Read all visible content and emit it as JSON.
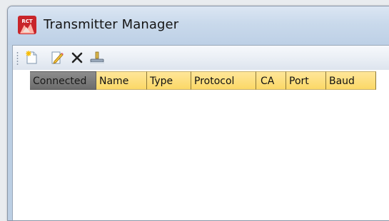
{
  "window": {
    "title": "Transmitter Manager"
  },
  "toolbar": {
    "buttons": [
      {
        "name": "new",
        "icon": "new-document-icon"
      },
      {
        "name": "edit",
        "icon": "edit-pencil-icon"
      },
      {
        "name": "delete",
        "icon": "delete-x-icon"
      },
      {
        "name": "connect",
        "icon": "network-connect-icon"
      }
    ]
  },
  "grid": {
    "columns": [
      "Connected",
      "Name",
      "Type",
      "Protocol",
      "CA",
      "Port",
      "Baud"
    ],
    "sorted_column": "Connected",
    "rows": []
  },
  "colors": {
    "header_bg": "#fbd867",
    "active_header_bg": "#7a7a7a",
    "title_bar": "#c9d9eb"
  }
}
